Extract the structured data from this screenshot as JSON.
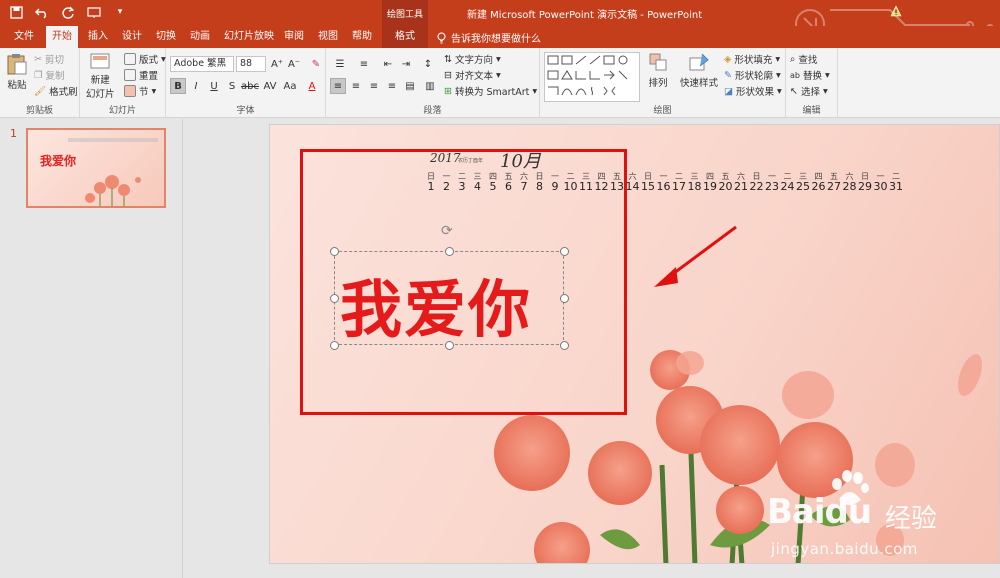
{
  "titlebar": {
    "context_tools": "绘图工具",
    "document_title": "新建 Microsoft PowerPoint 演示文稿  -  PowerPoint"
  },
  "tabs": [
    "文件",
    "开始",
    "插入",
    "设计",
    "切换",
    "动画",
    "幻灯片放映",
    "审阅",
    "视图",
    "帮助",
    "格式"
  ],
  "active_tab": "开始",
  "tell_me": "告诉我你想要做什么",
  "ribbon": {
    "clipboard": {
      "paste": "粘贴",
      "cut": "剪切",
      "copy": "复制",
      "format_painter": "格式刷",
      "label": "剪贴板"
    },
    "slides": {
      "new_slide": "新建\n幻灯片",
      "new_slide_line1": "新建",
      "new_slide_line2": "幻灯片",
      "layout": "版式",
      "reset": "重置",
      "section": "节",
      "label": "幻灯片"
    },
    "font": {
      "name": "Adobe 繁黑",
      "size": "88",
      "label": "字体"
    },
    "paragraph": {
      "text_direction": "文字方向",
      "align_text": "对齐文本",
      "convert_smartart": "转换为 SmartArt",
      "label": "段落"
    },
    "drawing": {
      "arrange": "排列",
      "quick_styles": "快速样式",
      "shape_fill": "形状填充",
      "shape_outline": "形状轮廓",
      "shape_effects": "形状效果",
      "label": "绘图"
    },
    "editing": {
      "find": "查找",
      "replace": "替换",
      "select": "选择",
      "label": "编辑"
    }
  },
  "thumbnail": {
    "number": "1",
    "title": "我爱你"
  },
  "slide": {
    "year": "2017",
    "year_sub": "农历丁酉年",
    "month": "10月",
    "weekdays": [
      "日",
      "一",
      "二",
      "三",
      "四",
      "五",
      "六",
      "日",
      "一",
      "二",
      "三",
      "四",
      "五",
      "六",
      "日",
      "一",
      "二",
      "三",
      "四",
      "五",
      "六",
      "日",
      "一",
      "二",
      "三",
      "四",
      "五",
      "六",
      "日",
      "一",
      "二"
    ],
    "days": [
      "1",
      "2",
      "3",
      "4",
      "5",
      "6",
      "7",
      "8",
      "9",
      "10",
      "11",
      "12",
      "13",
      "14",
      "15",
      "16",
      "17",
      "18",
      "19",
      "20",
      "21",
      "22",
      "23",
      "24",
      "25",
      "26",
      "27",
      "28",
      "29",
      "30",
      "31"
    ],
    "main_text": "我爱你"
  },
  "watermark": {
    "logo": "Baidu",
    "cn": "经验",
    "url": "jingyan.baidu.com"
  },
  "colors": {
    "accent": "#c43e1c",
    "main_text": "#e51b1b",
    "highlight_box": "#e01010",
    "arrow": "#e01010"
  }
}
